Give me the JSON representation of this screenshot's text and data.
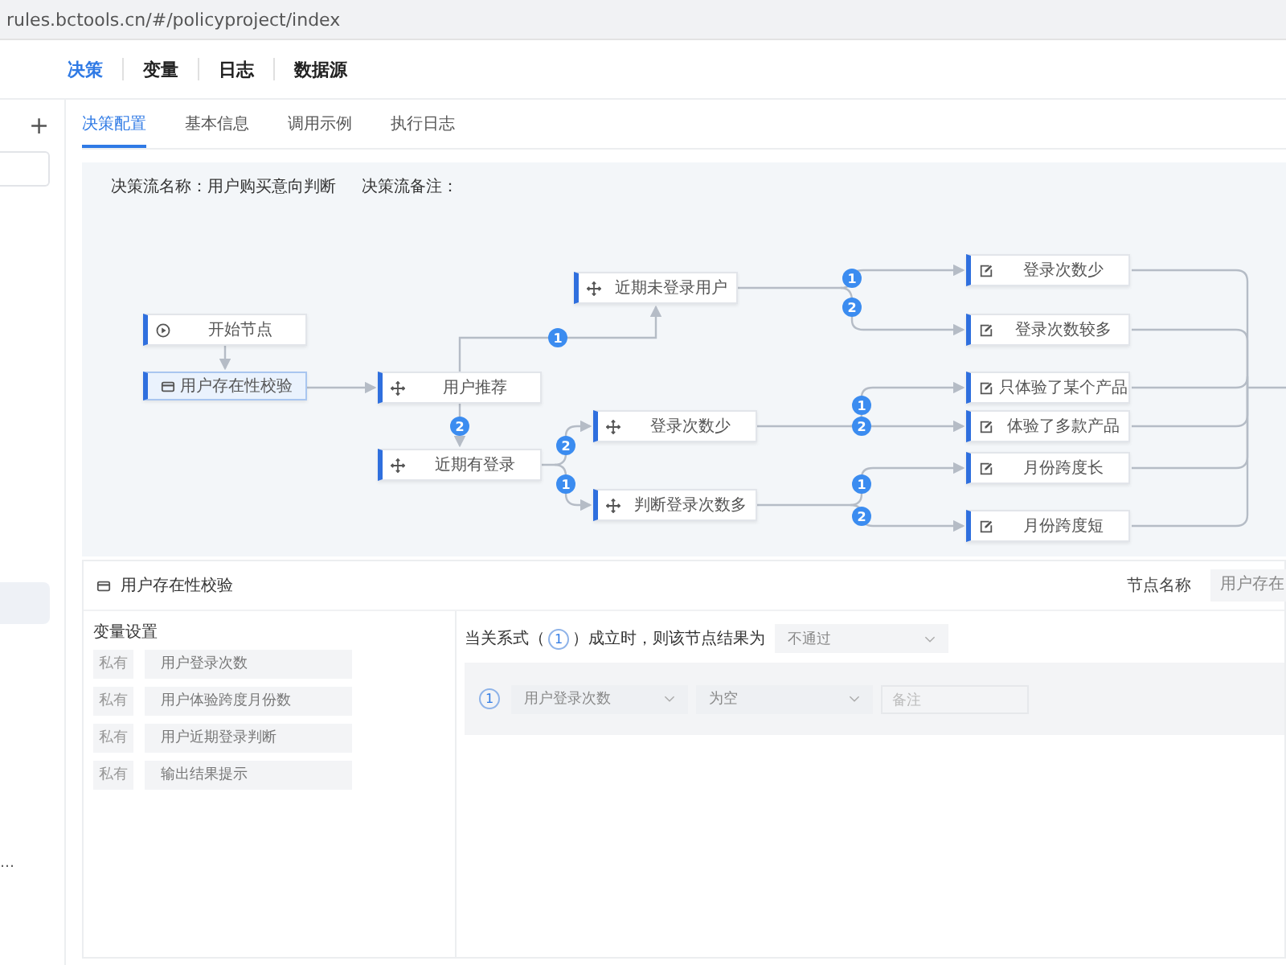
{
  "browser": {
    "url": "rules.bctools.cn/#/policyproject/index"
  },
  "nav": [
    {
      "label": "决策",
      "selected": true
    },
    {
      "label": "变量",
      "selected": false
    },
    {
      "label": "日志",
      "selected": false
    },
    {
      "label": "数据源",
      "selected": false
    }
  ],
  "sidebar": {
    "add_label": "+",
    "truncated_item": "…"
  },
  "tabs": [
    {
      "label": "决策配置",
      "selected": true
    },
    {
      "label": "基本信息",
      "selected": false
    },
    {
      "label": "调用示例",
      "selected": false
    },
    {
      "label": "执行日志",
      "selected": false
    }
  ],
  "flow": {
    "name_label": "决策流名称：",
    "name": "用户购买意向判断",
    "note_label": "决策流备注："
  },
  "nodes": [
    {
      "kind": "start",
      "label": "开始节点",
      "selected": false
    },
    {
      "kind": "check",
      "label": "用户存在性校验",
      "selected": true
    },
    {
      "kind": "branch",
      "label": "用户推荐",
      "selected": false
    },
    {
      "kind": "branch",
      "label": "近期有登录",
      "selected": false
    },
    {
      "kind": "branch",
      "label": "近期未登录用户",
      "selected": false
    },
    {
      "kind": "branch",
      "label": "登录次数少",
      "selected": false
    },
    {
      "kind": "branch",
      "label": "判断登录次数多",
      "selected": false
    },
    {
      "kind": "action",
      "label": "登录次数少",
      "selected": false
    },
    {
      "kind": "action",
      "label": "登录次数较多",
      "selected": false
    },
    {
      "kind": "action",
      "label": "只体验了某个产品",
      "selected": false
    },
    {
      "kind": "action",
      "label": "体验了多款产品",
      "selected": false
    },
    {
      "kind": "action",
      "label": "月份跨度长",
      "selected": false
    },
    {
      "kind": "action",
      "label": "月份跨度短",
      "selected": false
    }
  ],
  "branch_badges": [
    "1",
    "2",
    "2",
    "1",
    "1",
    "2",
    "1",
    "2",
    "1",
    "2"
  ],
  "node_panel": {
    "title": "用户存在性校验",
    "name_label": "节点名称",
    "name_value": "用户存在",
    "variables_title": "变量设置",
    "variables": [
      {
        "scope": "私有",
        "name": "用户登录次数"
      },
      {
        "scope": "私有",
        "name": "用户体验跨度月份数"
      },
      {
        "scope": "私有",
        "name": "用户近期登录判断"
      },
      {
        "scope": "私有",
        "name": "输出结果提示"
      }
    ],
    "rule": {
      "prefix": "当关系式（",
      "index": "1",
      "suffix": "）成立时，则该节点结果为",
      "result": "不通过"
    },
    "conditions": [
      {
        "index": "1",
        "variable": "用户登录次数",
        "operator": "为空",
        "note_placeholder": "备注"
      }
    ]
  }
}
